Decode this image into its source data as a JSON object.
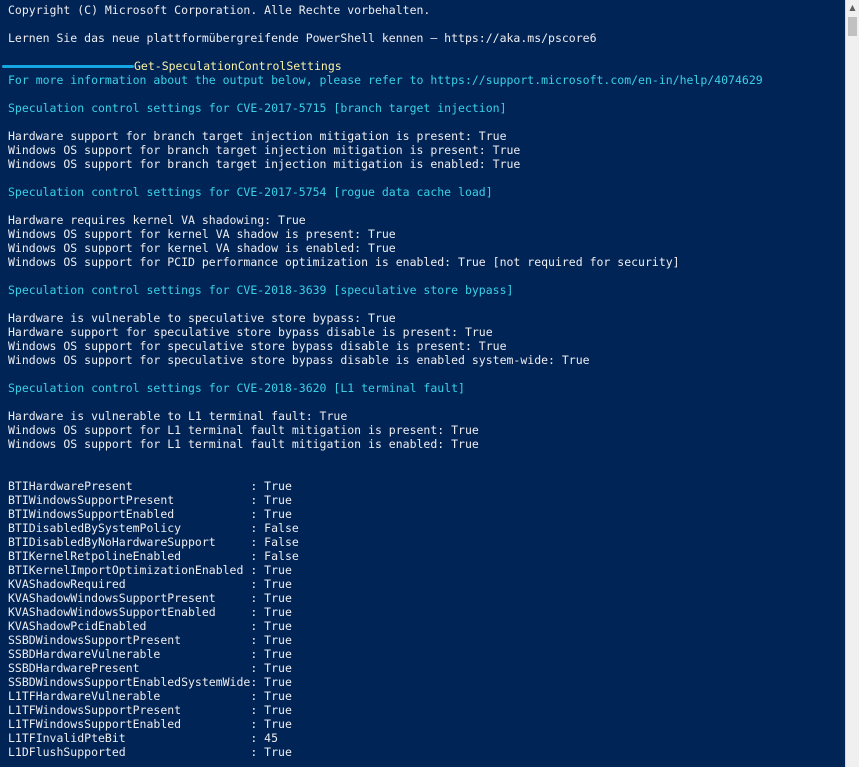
{
  "header": {
    "copyright": "Copyright (C) Microsoft Corporation. Alle Rechte vorbehalten.",
    "learn": "Lernen Sie das neue plattformübergreifende PowerShell kennen – https://aka.ms/pscore6"
  },
  "command": "Get-SpeculationControlSettings",
  "info": "For more information about the output below, please refer to https://support.microsoft.com/en-in/help/4074629",
  "sections": [
    {
      "title": "Speculation control settings for CVE-2017-5715 [branch target injection]",
      "lines": [
        "Hardware support for branch target injection mitigation is present: True",
        "Windows OS support for branch target injection mitigation is present: True",
        "Windows OS support for branch target injection mitigation is enabled: True"
      ]
    },
    {
      "title": "Speculation control settings for CVE-2017-5754 [rogue data cache load]",
      "lines": [
        "Hardware requires kernel VA shadowing: True",
        "Windows OS support for kernel VA shadow is present: True",
        "Windows OS support for kernel VA shadow is enabled: True",
        "Windows OS support for PCID performance optimization is enabled: True [not required for security]"
      ]
    },
    {
      "title": "Speculation control settings for CVE-2018-3639 [speculative store bypass]",
      "lines": [
        "Hardware is vulnerable to speculative store bypass: True",
        "Hardware support for speculative store bypass disable is present: True",
        "Windows OS support for speculative store bypass disable is present: True",
        "Windows OS support for speculative store bypass disable is enabled system-wide: True"
      ]
    },
    {
      "title": "Speculation control settings for CVE-2018-3620 [L1 terminal fault]",
      "lines": [
        "Hardware is vulnerable to L1 terminal fault: True",
        "Windows OS support for L1 terminal fault mitigation is present: True",
        "Windows OS support for L1 terminal fault mitigation is enabled: True"
      ]
    }
  ],
  "properties": [
    {
      "name": "BTIHardwarePresent",
      "value": "True"
    },
    {
      "name": "BTIWindowsSupportPresent",
      "value": "True"
    },
    {
      "name": "BTIWindowsSupportEnabled",
      "value": "True"
    },
    {
      "name": "BTIDisabledBySystemPolicy",
      "value": "False"
    },
    {
      "name": "BTIDisabledByNoHardwareSupport",
      "value": "False"
    },
    {
      "name": "BTIKernelRetpolineEnabled",
      "value": "False"
    },
    {
      "name": "BTIKernelImportOptimizationEnabled",
      "value": "True"
    },
    {
      "name": "KVAShadowRequired",
      "value": "True"
    },
    {
      "name": "KVAShadowWindowsSupportPresent",
      "value": "True"
    },
    {
      "name": "KVAShadowWindowsSupportEnabled",
      "value": "True"
    },
    {
      "name": "KVAShadowPcidEnabled",
      "value": "True"
    },
    {
      "name": "SSBDWindowsSupportPresent",
      "value": "True"
    },
    {
      "name": "SSBDHardwareVulnerable",
      "value": "True"
    },
    {
      "name": "SSBDHardwarePresent",
      "value": "True"
    },
    {
      "name": "SSBDWindowsSupportEnabledSystemWide",
      "value": "True"
    },
    {
      "name": "L1TFHardwareVulnerable",
      "value": "True"
    },
    {
      "name": "L1TFWindowsSupportPresent",
      "value": "True"
    },
    {
      "name": "L1TFWindowsSupportEnabled",
      "value": "True"
    },
    {
      "name": "L1TFInvalidPteBit",
      "value": "45"
    },
    {
      "name": "L1DFlushSupported",
      "value": "True"
    }
  ],
  "colors": {
    "background": "#012456",
    "text": "#eeedf0",
    "info": "#3ad1e8",
    "command": "#f9f1a5"
  }
}
